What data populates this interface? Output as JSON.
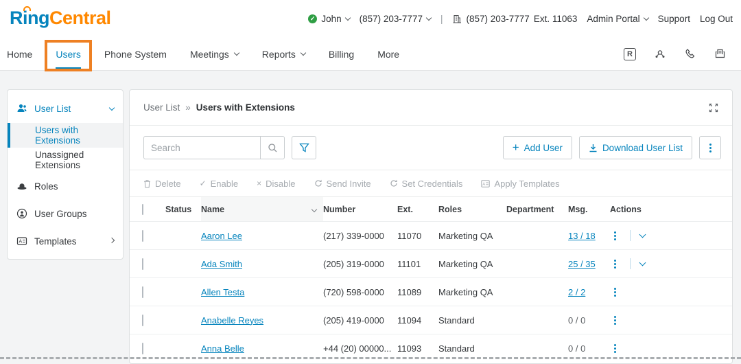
{
  "brand": {
    "ring": "Ring",
    "central": "Central"
  },
  "topbar": {
    "user_name": "John",
    "direct_number": "(857) 203-7777",
    "divider": "|",
    "company_number": "(857) 203-7777",
    "company_ext": "Ext. 11063",
    "admin_portal": "Admin Portal",
    "support": "Support",
    "log_out": "Log Out"
  },
  "nav": {
    "items": [
      {
        "label": "Home"
      },
      {
        "label": "Users"
      },
      {
        "label": "Phone System"
      },
      {
        "label": "Meetings"
      },
      {
        "label": "Reports"
      },
      {
        "label": "Billing"
      },
      {
        "label": "More"
      }
    ]
  },
  "sidebar": {
    "user_list": "User List",
    "users_with_extensions": "Users with Extensions",
    "unassigned_extensions": "Unassigned Extensions",
    "roles": "Roles",
    "user_groups": "User Groups",
    "templates": "Templates"
  },
  "panel": {
    "breadcrumb": {
      "parent": "User List",
      "separator": "»",
      "current": "Users with Extensions"
    },
    "search": {
      "placeholder": "Search"
    },
    "buttons": {
      "add_user": "Add User",
      "download": "Download User List"
    },
    "toolbar": {
      "delete": "Delete",
      "enable": "Enable",
      "disable": "Disable",
      "send_invite": "Send Invite",
      "set_credentials": "Set Credentials",
      "apply_templates": "Apply Templates"
    },
    "table": {
      "columns": [
        "Status",
        "Name",
        "Number",
        "Ext.",
        "Roles",
        "Department",
        "Msg.",
        "Actions"
      ],
      "rows": [
        {
          "status": "active",
          "name": "Aaron Lee",
          "number": "(217) 339-0000",
          "ext": "11070",
          "roles": "Marketing QA",
          "department": "",
          "msg": "13 / 18"
        },
        {
          "status": "active",
          "name": "Ada Smith",
          "number": "(205) 319-0000",
          "ext": "11101",
          "roles": "Marketing QA",
          "department": "",
          "msg": "25 / 35"
        },
        {
          "status": "invited",
          "name": "Allen Testa",
          "number": "(720) 598-0000",
          "ext": "11089",
          "roles": "Marketing QA",
          "department": "",
          "msg": "2 / 2"
        },
        {
          "status": "active",
          "name": "Anabelle Reyes",
          "number": "(205) 419-0000",
          "ext": "11094",
          "roles": "Standard",
          "department": "",
          "msg": "0 / 0"
        },
        {
          "status": "active",
          "name": "Anna Belle",
          "number": "+44 (20) 00000...",
          "ext": "11093",
          "roles": "Standard",
          "department": "",
          "msg": "0 / 0"
        }
      ]
    }
  },
  "colors": {
    "accent_blue": "#0684bd",
    "logo_orange": "#ff8800",
    "annotation_orange": "#ee8023",
    "status_green": "#2f9e44",
    "status_gray": "#6f7377"
  }
}
